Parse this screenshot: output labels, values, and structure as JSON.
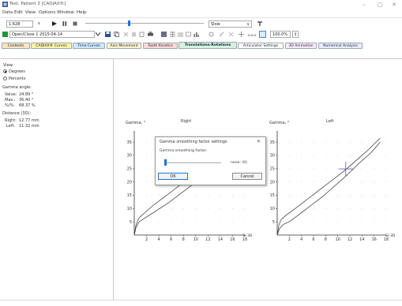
{
  "window": {
    "title": "Test, Patient 3 [CADIAX®]",
    "min_glyph": "–",
    "max_glyph": "□",
    "close_glyph": "✕"
  },
  "menu": [
    "Data",
    "Edit",
    "View",
    "Options",
    "Window",
    "Help"
  ],
  "toolbar1": {
    "ratio_value": "1.628",
    "ratio_unit": "s",
    "speed_value": "Slow",
    "speed_arrow": "∨"
  },
  "toolbar2": {
    "session_value": "Open/Close 1 2015-04-14",
    "zoom_value": "100.0%",
    "zoom_spin": "↕"
  },
  "tabs": [
    {
      "label": "Contents",
      "color": "#fbe3c1"
    },
    {
      "label": "CADIAX® Curves",
      "color": "#fff3a8"
    },
    {
      "label": "Time Curves",
      "color": "#cfe6ff"
    },
    {
      "label": "Axis Movement",
      "color": "#fff1cf"
    },
    {
      "label": "Tooth Kinetics",
      "color": "#ffd9d9"
    },
    {
      "label": "Translations-Rotations",
      "color": "#d6f0e2"
    },
    {
      "label": "Articulator Settings",
      "color": "#ffffff"
    },
    {
      "label": "3D Animation",
      "color": "#ffe9ff"
    },
    {
      "label": "Numerical Analysis",
      "color": "#e9ecff"
    }
  ],
  "left_panel": {
    "view_label": "View:",
    "opt_degrees": "Degrees",
    "opt_percents": "Percents",
    "gamma_heading": "Gamma angle:",
    "value_label": "Value:",
    "value_val": "24.89 °",
    "max_label": "Max.:",
    "max_val": "36.40 °",
    "pct_label": "%/%:",
    "pct_val": "68.37 %",
    "distance_heading": "Distance (3D):",
    "right_label": "Right:",
    "right_val": "12.77 mm",
    "left_label": "Left:",
    "left_val": "11.32 mm"
  },
  "charts_text": {
    "right_ylabel": "Gamma, °",
    "right_title": "Right",
    "left_ylabel": "Gamma, °",
    "left_title": "Left",
    "xunit": "Sr-3D"
  },
  "dialog": {
    "title": "Gamma smoothing factor settings",
    "close_glyph": "✕",
    "field_label": "Gamma smoothing factor:",
    "slider_value_text": "none: (0)",
    "ok_label": "OK",
    "cancel_label": "Cancel",
    "slider_fraction": 0.0
  },
  "chart_data": [
    {
      "type": "line",
      "title": "Right",
      "ylabel": "Gamma, °",
      "xlabel": "Sr-3D",
      "xlim": [
        0,
        18
      ],
      "ylim": [
        0,
        38
      ],
      "x_ticks": [
        2,
        4,
        6,
        8,
        10,
        12,
        14,
        16,
        18
      ],
      "y_ticks": [
        5,
        10,
        15,
        20,
        25,
        30,
        35
      ],
      "grid": "dotted",
      "series": [
        {
          "x": [
            0,
            0.3,
            0.8,
            1.5,
            3,
            5,
            7,
            9,
            11,
            13,
            15,
            17.5
          ],
          "y": [
            0,
            4,
            6.5,
            8,
            11,
            14.5,
            18,
            21.5,
            25,
            29,
            33,
            37
          ]
        },
        {
          "x": [
            0,
            0.3,
            0.8,
            1.8,
            3.5,
            5.5,
            7.5,
            9.5,
            11.5,
            13.5,
            15.5,
            17.5
          ],
          "y": [
            0,
            3,
            5,
            6.5,
            9,
            12,
            15.5,
            19,
            23,
            27,
            31.5,
            36
          ]
        }
      ]
    },
    {
      "type": "line",
      "title": "Left",
      "ylabel": "Gamma, °",
      "xlabel": "Sr-3D",
      "xlim": [
        0,
        18
      ],
      "ylim": [
        0,
        38
      ],
      "x_ticks": [
        2,
        4,
        6,
        8,
        10,
        12,
        14,
        16,
        18
      ],
      "y_ticks": [
        5,
        10,
        15,
        20,
        25,
        30,
        35
      ],
      "grid": "dotted",
      "cursor": {
        "x": 11.32,
        "y": 24.89
      },
      "series": [
        {
          "x": [
            0,
            0.3,
            0.7,
            1.5,
            3,
            5,
            7,
            9,
            11,
            13,
            15,
            17
          ],
          "y": [
            0,
            4,
            6,
            7.5,
            10,
            13.5,
            17,
            20.5,
            24,
            28,
            32,
            36.5
          ]
        },
        {
          "x": [
            0,
            0.4,
            1,
            2,
            3.5,
            5.5,
            7.5,
            9.5,
            11.5,
            13.5,
            15.5,
            17
          ],
          "y": [
            0,
            2.5,
            4,
            5,
            7.5,
            11,
            14.5,
            18.5,
            22.5,
            27,
            31,
            35
          ]
        }
      ]
    }
  ]
}
